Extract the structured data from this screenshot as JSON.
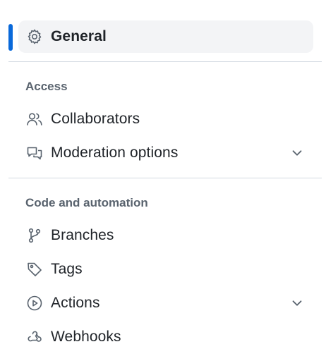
{
  "sidebar": {
    "general": {
      "label": "General",
      "icon": "gear-icon"
    },
    "access": {
      "heading": "Access",
      "items": [
        {
          "label": "Collaborators",
          "icon": "people-icon"
        },
        {
          "label": "Moderation options",
          "icon": "report-icon"
        }
      ]
    },
    "code_automation": {
      "heading": "Code and automation",
      "items": [
        {
          "label": "Branches",
          "icon": "git-branch-icon"
        },
        {
          "label": "Tags",
          "icon": "tag-icon"
        },
        {
          "label": "Actions",
          "icon": "play-icon"
        },
        {
          "label": "Webhooks",
          "icon": "webhook-icon"
        }
      ]
    }
  },
  "colors": {
    "accent": "#0969da",
    "active_bg": "#f3f4f6",
    "muted": "#59636e",
    "text": "#1f2328",
    "border": "#d1d9e0"
  }
}
